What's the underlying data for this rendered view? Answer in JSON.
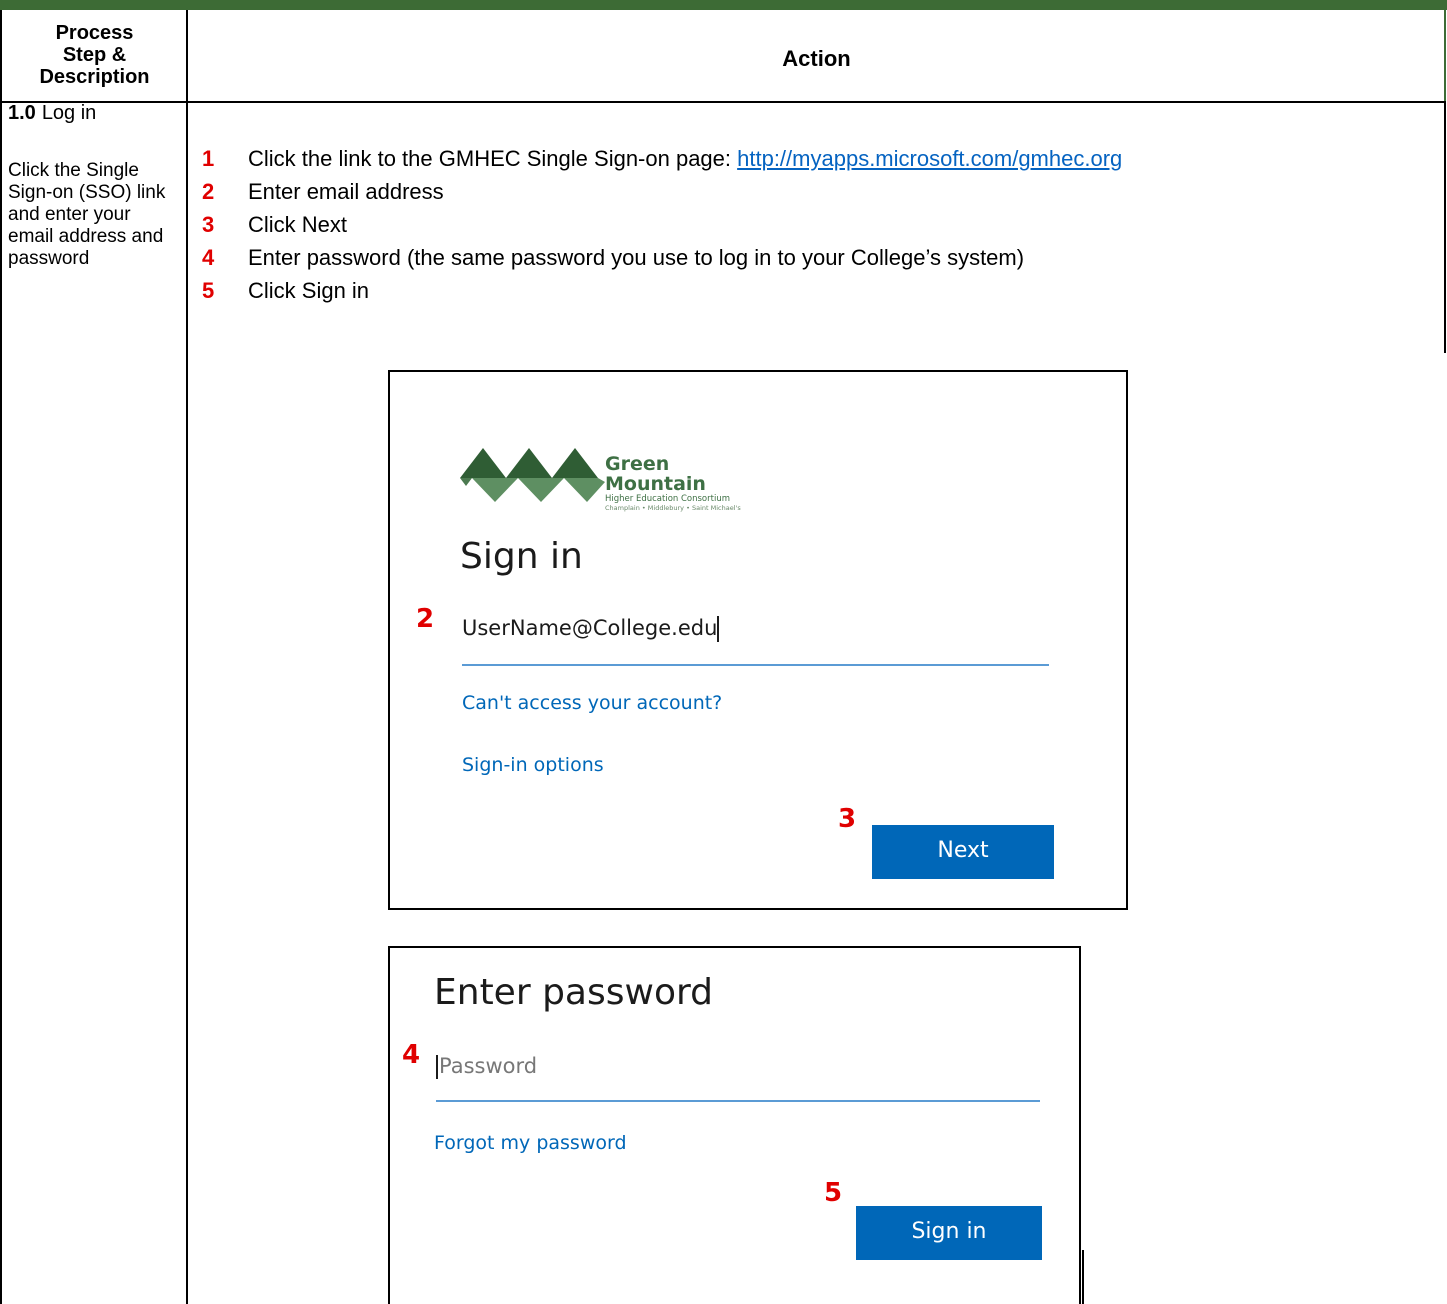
{
  "header": {
    "step_col_line1": "Process",
    "step_col_line2": "Step &",
    "step_col_line3": "Description",
    "action_col": "Action"
  },
  "step": {
    "number": "1.0",
    "title": "Log in",
    "description": "Click the Single Sign-on (SSO) link and enter your email address and password"
  },
  "actions": [
    {
      "num": "1",
      "text": "Click the link to the GMHEC Single Sign-on page: ",
      "link": "http://myapps.microsoft.com/gmhec.org"
    },
    {
      "num": "2",
      "text": "Enter email address"
    },
    {
      "num": "3",
      "text": "Click Next"
    },
    {
      "num": "4",
      "text": "Enter password (the same password you use to log in to your College’s system)"
    },
    {
      "num": "5",
      "text": "Click Sign in"
    }
  ],
  "signin_screen": {
    "logo_name": "Green Mountain",
    "logo_sub": "Higher Education Consortium",
    "logo_sub2": "Champlain • Middlebury • Saint Michael's",
    "title": "Sign in",
    "email_value": "UserName@College.edu",
    "link_cant_access": "Can't access your account?",
    "link_options": "Sign-in options",
    "next_button": "Next",
    "callout_email": "2",
    "callout_next": "3"
  },
  "password_screen": {
    "title": "Enter password",
    "password_placeholder": "Password",
    "link_forgot": "Forgot my password",
    "signin_button": "Sign in",
    "callout_password": "4",
    "callout_signin": "5"
  },
  "colors": {
    "accent_green": "#3d6b35",
    "callout_red": "#e00000",
    "ms_blue": "#0067b8",
    "link_blue": "#0563c1"
  }
}
